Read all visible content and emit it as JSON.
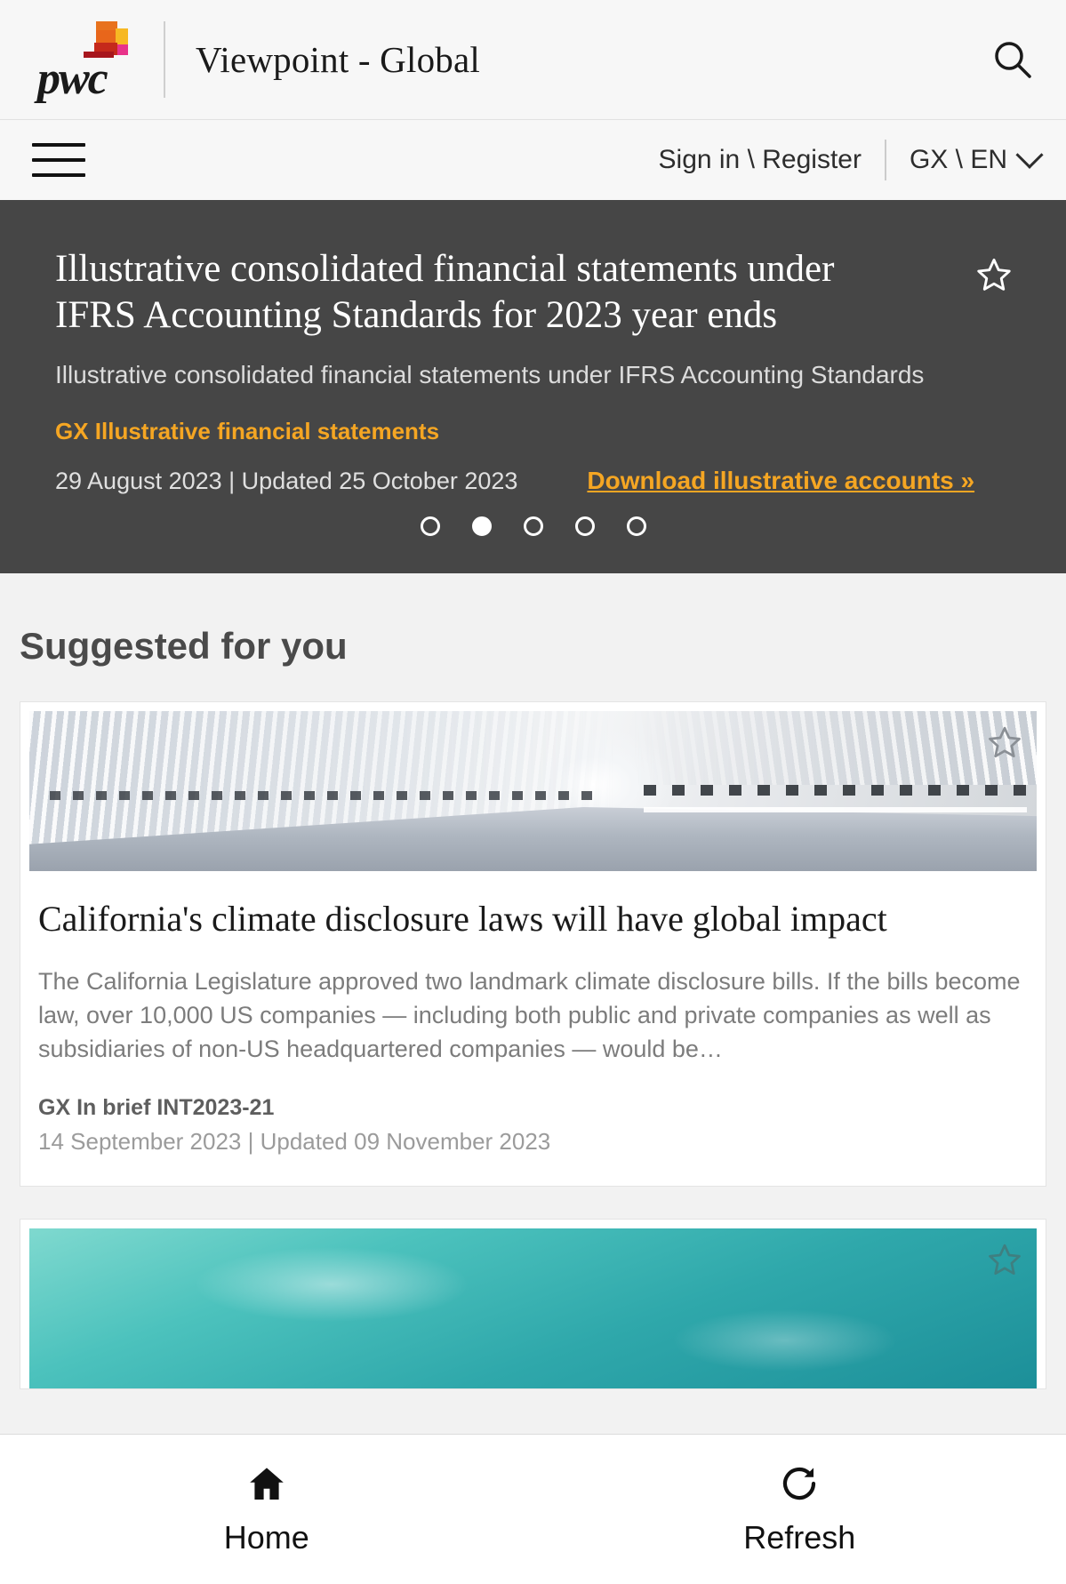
{
  "brand": {
    "logo_text": "pwc",
    "logo_icon": "pwc-logo",
    "site_title": "Viewpoint - Global",
    "search_icon": "search-icon"
  },
  "nav": {
    "menu_icon": "hamburger-menu-icon",
    "sign_in": "Sign in \\ Register",
    "locale": "GX \\ EN",
    "chevron_icon": "chevron-down-icon"
  },
  "hero": {
    "title": "Illustrative consolidated financial statements under IFRS Accounting Standards for 2023 year ends",
    "subtitle": "Illustrative consolidated financial statements under IFRS Accounting Standards",
    "tag": "GX Illustrative financial statements",
    "date": "29 August 2023 | Updated 25 October 2023",
    "download_label": "Download illustrative accounts »",
    "bookmark_icon": "star-outline-icon",
    "carousel": {
      "total": 5,
      "active_index": 1
    },
    "accent_color": "#f5a623",
    "background_color": "#464646"
  },
  "suggested": {
    "heading": "Suggested for you",
    "cards": [
      {
        "image_alt": "tunnel-photo",
        "bookmark_icon": "star-outline-icon",
        "title": "California's climate disclosure laws will have global impact",
        "description": "The California Legislature approved two landmark climate disclosure bills. If the bills become law, over 10,000 US companies — including both public and private companies as well as subsidiaries of non-US headquartered companies — would be…",
        "tag": "GX In brief INT2023-21",
        "date": "14 September 2023 | Updated 09 November 2023"
      },
      {
        "image_alt": "ocean-photo",
        "bookmark_icon": "star-outline-icon",
        "title": "",
        "description": "",
        "tag": "",
        "date": ""
      }
    ]
  },
  "bottom_nav": {
    "items": [
      {
        "label": "Home",
        "icon": "home-icon"
      },
      {
        "label": "Refresh",
        "icon": "refresh-icon"
      }
    ]
  }
}
